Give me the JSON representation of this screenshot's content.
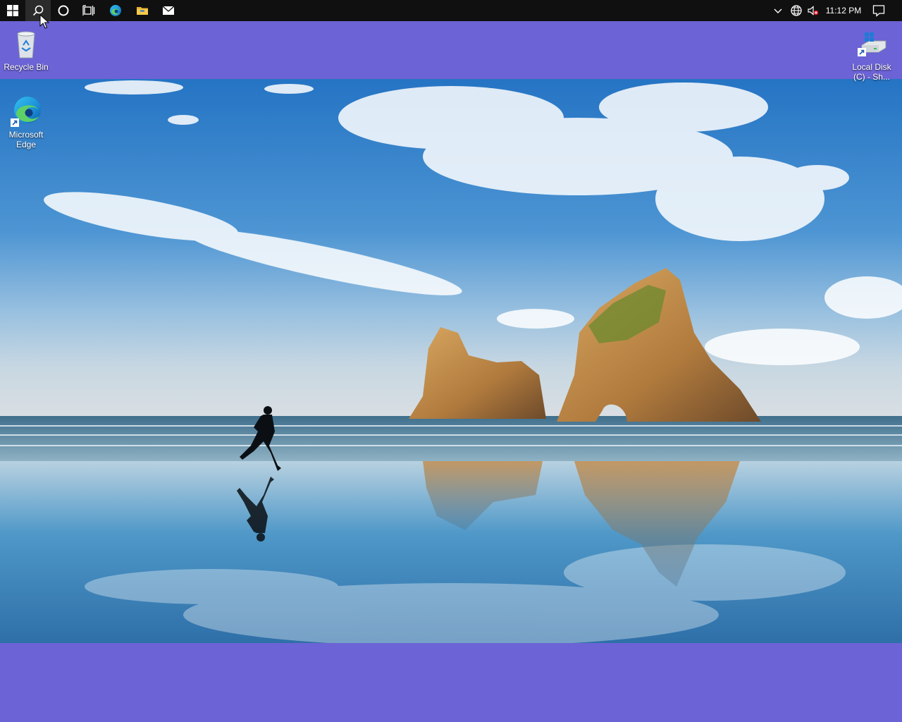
{
  "taskbar": {
    "clock": "11:12 PM",
    "buttons": [
      {
        "name": "Start"
      },
      {
        "name": "Search"
      },
      {
        "name": "Cortana"
      },
      {
        "name": "Task View"
      },
      {
        "name": "Microsoft Edge"
      },
      {
        "name": "File Explorer"
      },
      {
        "name": "Mail"
      }
    ],
    "tray_icons": [
      "chevron-up-icon",
      "network-globe-icon",
      "volume-muted-icon",
      "action-center-icon"
    ]
  },
  "desktop": {
    "background_color": "#6c63d6",
    "icons": [
      {
        "label": "Recycle Bin",
        "icon": "recycle-bin-icon"
      },
      {
        "label": "Microsoft Edge",
        "icon": "edge-icon"
      },
      {
        "label": "Local Disk (C) - Sh...",
        "icon": "drive-icon"
      }
    ]
  }
}
